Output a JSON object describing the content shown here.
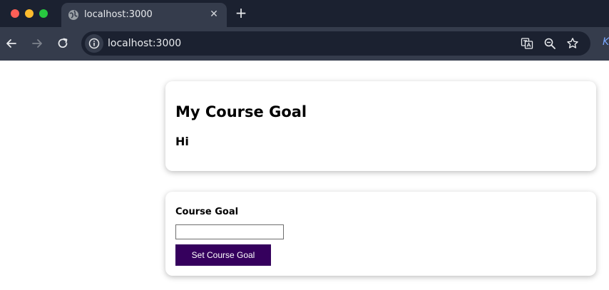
{
  "browser": {
    "tab": {
      "title": "localhost:3000",
      "icon": "globe-icon",
      "close_glyph": "✕"
    },
    "new_tab_glyph": "+",
    "toolbar": {
      "back_icon": "arrow-left-icon",
      "forward_icon": "arrow-right-icon",
      "reload_icon": "reload-icon",
      "site_info_icon": "info-icon",
      "url": "localhost:3000",
      "translate_icon": "translate-icon",
      "zoom_icon": "zoom-out-icon",
      "bookmark_icon": "star-icon",
      "extension_glyph": "K"
    },
    "colors": {
      "tabstrip": "#1b2130",
      "toolbar": "#353c4c",
      "text": "#e8eaed"
    }
  },
  "page": {
    "goal_card": {
      "heading": "My Course Goal",
      "goal": "Hi"
    },
    "form_card": {
      "label": "Course Goal",
      "input_value": "",
      "button_label": "Set Course Goal"
    },
    "colors": {
      "button": "#35005d",
      "button_text": "#ffffff"
    }
  }
}
